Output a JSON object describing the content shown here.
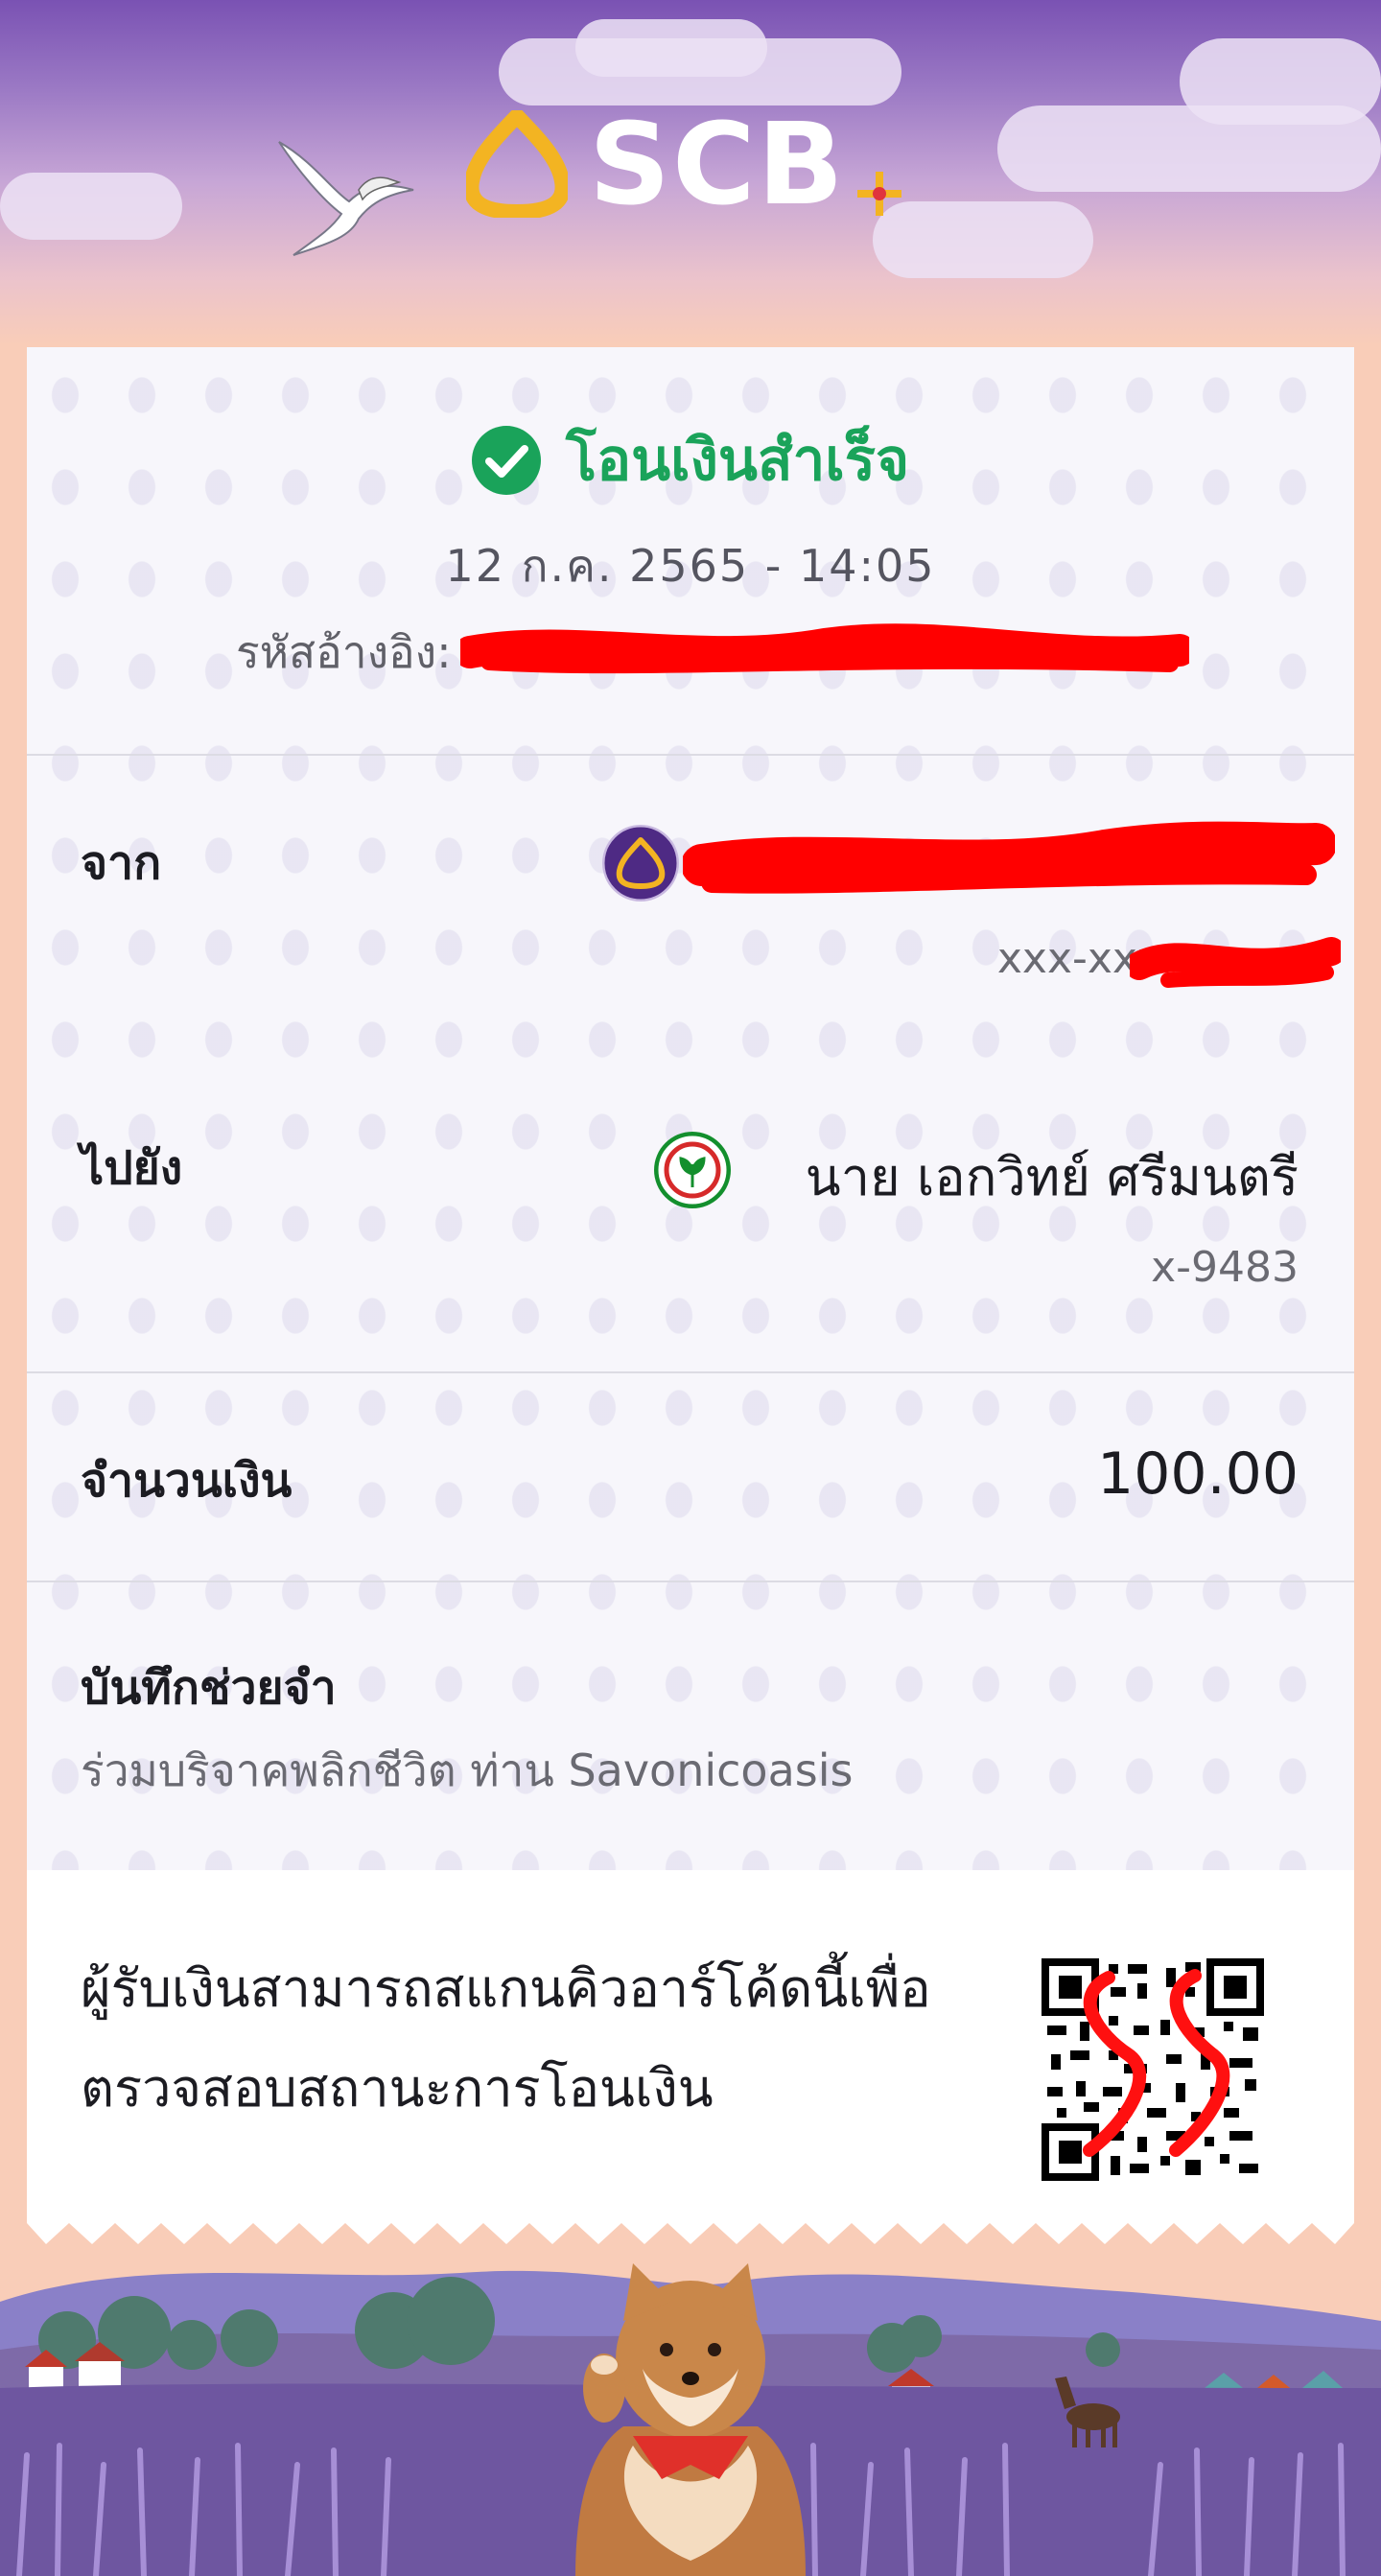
{
  "header": {
    "brand": "SCB",
    "icons": [
      "scb-logo-icon",
      "bird-icon",
      "sparkle-plus-icon"
    ]
  },
  "status": {
    "title": "โอนเงินสำเร็จ",
    "datetime": "12 ก.ค. 2565 - 14:05",
    "reference_label": "รหัสอ้างอิง:",
    "color_success": "#1aa35a"
  },
  "from": {
    "label": "จาก",
    "account": "xxx-xxx"
  },
  "to": {
    "label": "ไปยัง",
    "name": "นาย เอกวิทย์ ศรีมนตรี",
    "account": "x-9483"
  },
  "amount": {
    "label": "จำนวนเงิน",
    "value": "100.00"
  },
  "memo": {
    "label": "บันทึกช่วยจำ",
    "text": "ร่วมบริจาคพลิกชีวิต ท่าน Savonicoasis"
  },
  "qr": {
    "line1": "ผู้รับเงินสามารถสแกนคิวอาร์โค้ดนี้เพื่อ",
    "line2": "ตรวจสอบสถานะการโอนเงิน"
  },
  "colors": {
    "brand_purple": "#4e2a84",
    "brand_gold": "#f3b422",
    "kbank_green": "#138f2d",
    "redaction": "#ff0000"
  }
}
